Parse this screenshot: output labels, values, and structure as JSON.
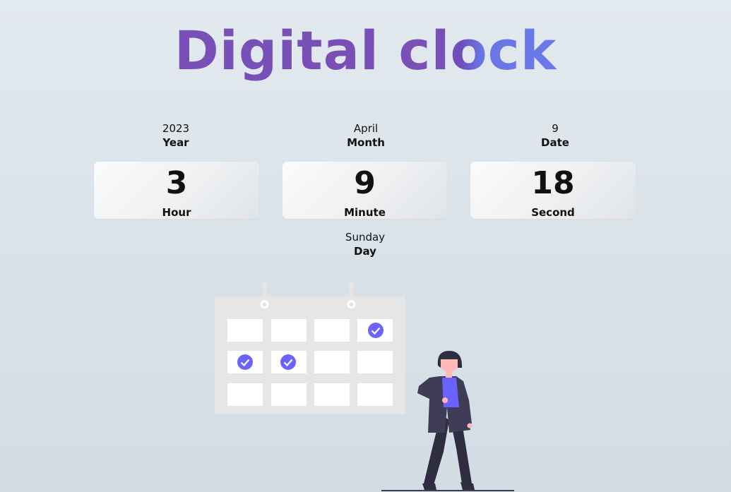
{
  "title": "Digital clock",
  "date_info": {
    "year": {
      "value": "2023",
      "label": "Year"
    },
    "month": {
      "value": "April",
      "label": "Month"
    },
    "date": {
      "value": "9",
      "label": "Date"
    }
  },
  "time": {
    "hour": {
      "value": "3",
      "label": "Hour"
    },
    "minute": {
      "value": "9",
      "label": "Minute"
    },
    "second": {
      "value": "18",
      "label": "Second"
    }
  },
  "day": {
    "value": "Sunday",
    "label": "Day"
  },
  "colors": {
    "title_gradient_start": "#7650b8",
    "title_gradient_end": "#6a7ff0",
    "accent_check": "#6c63ff",
    "background": "#dde4ea"
  },
  "illustration": {
    "icons": [
      "calendar-icon",
      "check-icon",
      "person-illustration"
    ]
  }
}
